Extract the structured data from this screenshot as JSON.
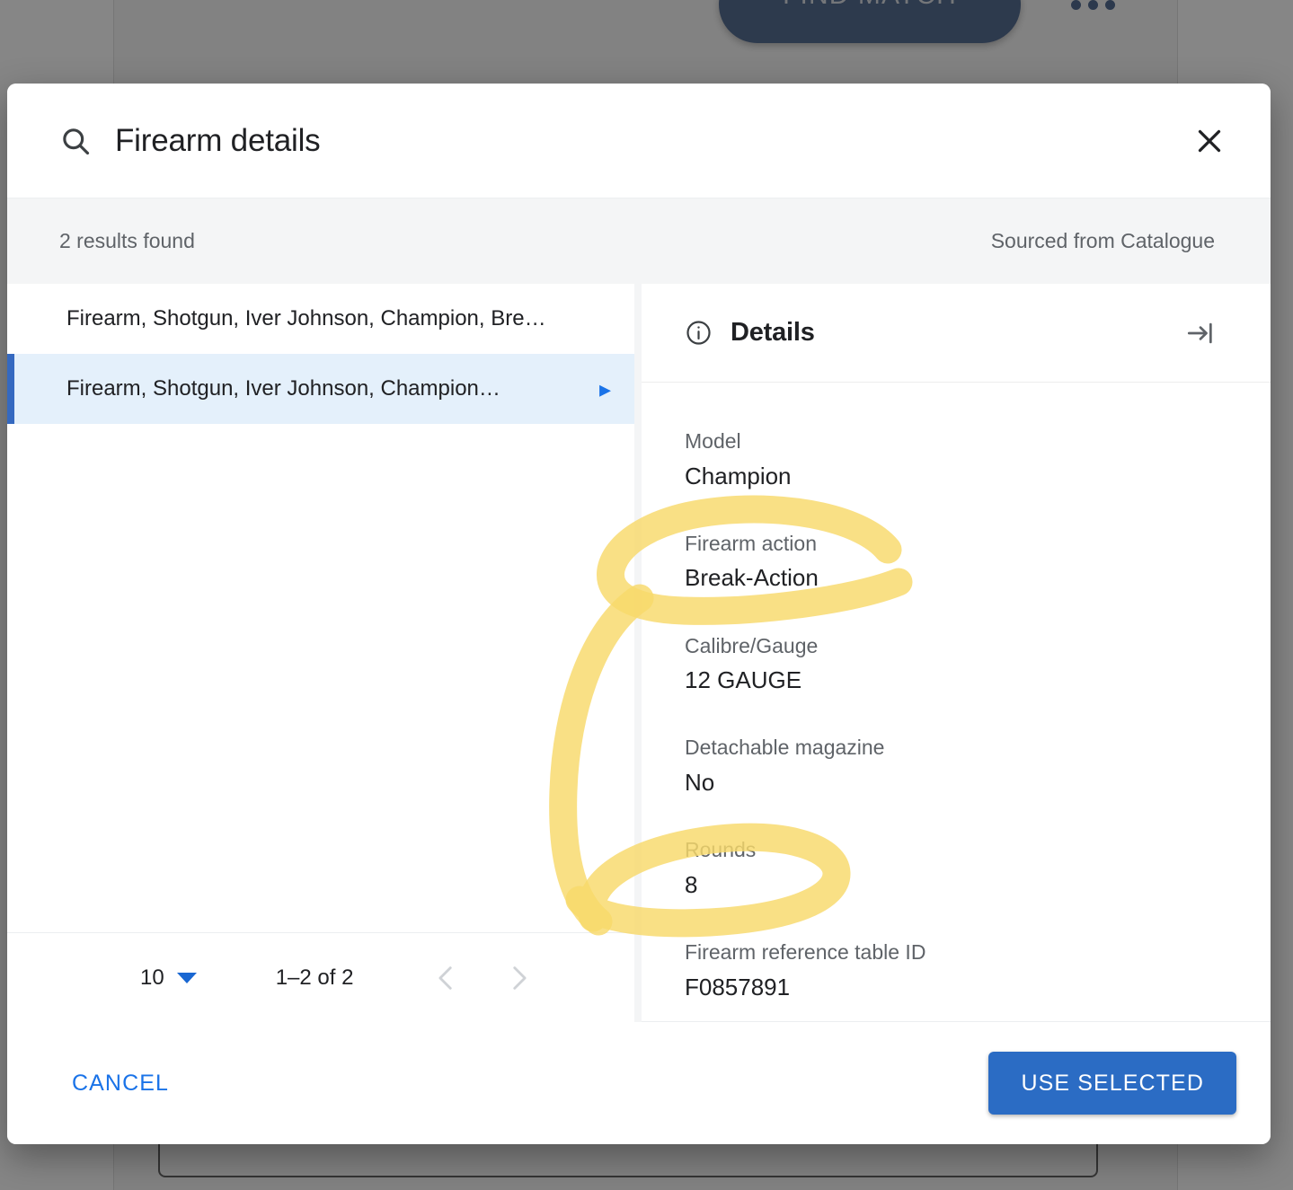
{
  "background": {
    "find_match_label": "FIND MATCH",
    "overflow_menu_name": "more-options"
  },
  "dialog": {
    "title": "Firearm details",
    "search_icon": "search-icon",
    "close_icon": "close-icon",
    "subheader": {
      "results_count": "2 results found",
      "source": "Sourced from Catalogue"
    },
    "results": [
      {
        "label": "Firearm, Shotgun, Iver Johnson, Champion, Bre…",
        "selected": false
      },
      {
        "label": "Firearm, Shotgun, Iver Johnson, Champion…",
        "selected": true
      }
    ],
    "paginator": {
      "page_size": "10",
      "page_size_caret_icon": "chevron-down-icon",
      "range_label": "1–2 of 2",
      "prev_icon": "chevron-left-icon",
      "next_icon": "chevron-right-icon"
    },
    "details": {
      "title": "Details",
      "info_icon": "info-circle-icon",
      "collapse_icon": "collapse-right-icon",
      "fields": [
        {
          "label": "Model",
          "value": "Champion"
        },
        {
          "label": "Firearm action",
          "value": "Break-Action"
        },
        {
          "label": "Calibre/Gauge",
          "value": "12 GAUGE"
        },
        {
          "label": "Detachable magazine",
          "value": "No"
        },
        {
          "label": "Rounds",
          "value": "8"
        },
        {
          "label": "Firearm reference table ID",
          "value": "F0857891"
        }
      ]
    },
    "footer": {
      "cancel_label": "CANCEL",
      "use_selected_label": "USE SELECTED"
    }
  },
  "annotation": {
    "type": "highlighter-circle",
    "color": "#f7d967",
    "targets": [
      "Firearm action / Break-Action",
      "Rounds / 8"
    ]
  },
  "colors": {
    "accent_blue": "#1a73e8",
    "primary_button": "#2b6cc4",
    "selected_row_bg": "#e4f0fb",
    "selected_row_bar": "#3569c0",
    "subheader_bg": "#f4f5f6",
    "label_gray": "#5f6368",
    "text_dark": "#202124",
    "highlighter": "#f7d967",
    "find_match_navy": "#17376b"
  }
}
